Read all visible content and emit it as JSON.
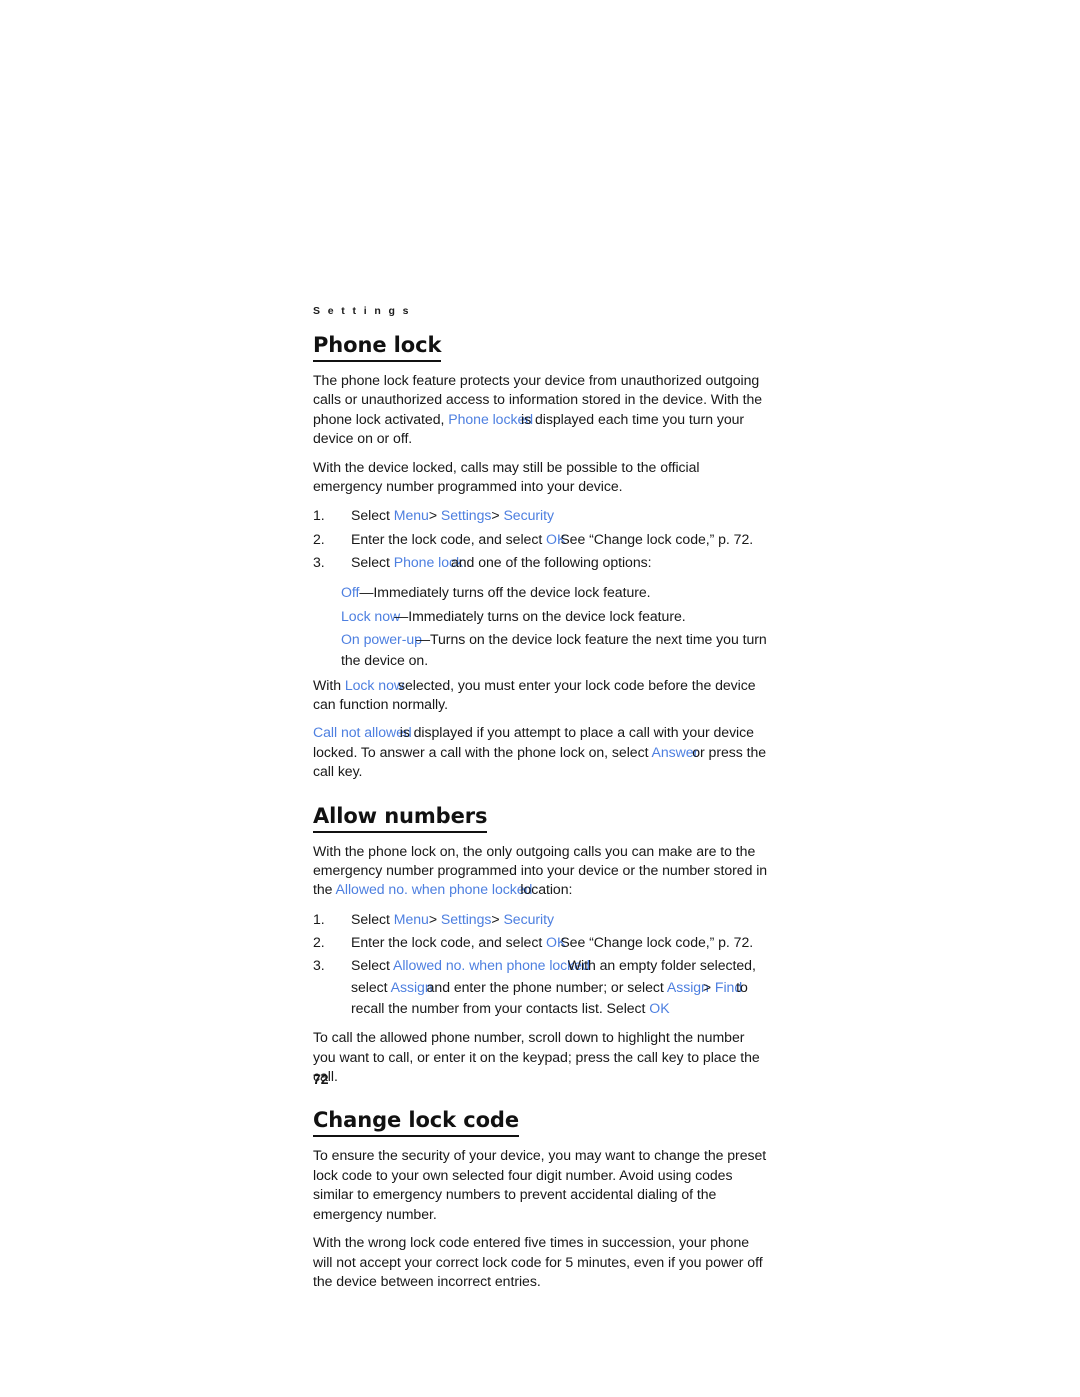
{
  "document": {
    "running_header": "S e t t i n g s",
    "page_number": "72",
    "accent_color": "#4d7fe0",
    "text_color": "#181818"
  },
  "sections": [
    {
      "heading": "Phone lock",
      "intro_paragraphs": [
        {
          "parts": [
            {
              "text": "The phone lock feature protects your device from unauthorized outgoing calls or unauthorized access to information stored in the device. With the phone lock activated, ",
              "style": "normal"
            },
            {
              "text": "Phone locked",
              "style": "ui-overlap"
            },
            {
              "text": "is displayed each time you turn your device on or off.",
              "style": "normal"
            }
          ]
        },
        {
          "parts": [
            {
              "text": "With the device locked, calls may still be possible to the official emergency number programmed into your device.",
              "style": "normal"
            }
          ]
        }
      ],
      "steps": [
        {
          "number": "1.",
          "parts": [
            {
              "text": "Select ",
              "style": "normal"
            },
            {
              "text": "Menu",
              "style": "ui"
            },
            {
              "text": "> ",
              "style": "normal"
            },
            {
              "text": "Settings",
              "style": "ui"
            },
            {
              "text": "> ",
              "style": "normal"
            },
            {
              "text": "Security",
              "style": "ui"
            }
          ]
        },
        {
          "number": "2.",
          "parts": [
            {
              "text": "Enter the lock code, and select ",
              "style": "normal"
            },
            {
              "text": "OK",
              "style": "ui-overlap-sm"
            },
            {
              "text": "See “Change lock code,” p. 72.",
              "style": "normal"
            }
          ]
        },
        {
          "number": "3.",
          "parts": [
            {
              "text": "Select ",
              "style": "normal"
            },
            {
              "text": "Phone lock",
              "style": "ui-overlap"
            },
            {
              "text": "and one of the following options:",
              "style": "normal"
            }
          ]
        }
      ],
      "options": [
        {
          "parts": [
            {
              "text": "Off",
              "style": "ui"
            },
            {
              "text": "—Immediately turns off the device lock feature.",
              "style": "normal"
            }
          ]
        },
        {
          "parts": [
            {
              "text": "Lock now",
              "style": "ui-overlap-sm"
            },
            {
              "text": "—Immediately turns on the device lock feature.",
              "style": "normal"
            }
          ]
        },
        {
          "parts": [
            {
              "text": "On power-up",
              "style": "ui-overlap-sm"
            },
            {
              "text": "—Turns on the device lock feature the next time you turn the device on.",
              "style": "normal"
            }
          ]
        }
      ],
      "outro_paragraphs": [
        {
          "parts": [
            {
              "text": "With ",
              "style": "normal"
            },
            {
              "text": "Lock now",
              "style": "ui-overlap-sm"
            },
            {
              "text": "selected, you must enter your lock code before the device can function normally.",
              "style": "normal"
            }
          ]
        },
        {
          "parts": [
            {
              "text": "Call not allowed",
              "style": "ui-overlap"
            },
            {
              "text": "is displayed if you attempt to place a call with your device locked. To answer a call with the phone lock on, select ",
              "style": "normal"
            },
            {
              "text": "Answer",
              "style": "ui-overlap-sm"
            },
            {
              "text": "or press the call key.",
              "style": "normal"
            }
          ]
        }
      ]
    },
    {
      "heading": "Allow numbers",
      "intro_paragraphs": [
        {
          "parts": [
            {
              "text": "With the phone lock on, the only outgoing calls you can make are to the emergency number programmed into your device or the number stored in the ",
              "style": "normal"
            },
            {
              "text": "Allowed no. when phone locked",
              "style": "ui-overlap"
            },
            {
              "text": "location:",
              "style": "normal"
            }
          ]
        }
      ],
      "steps": [
        {
          "number": "1.",
          "parts": [
            {
              "text": "Select ",
              "style": "normal"
            },
            {
              "text": "Menu",
              "style": "ui"
            },
            {
              "text": "> ",
              "style": "normal"
            },
            {
              "text": "Settings",
              "style": "ui"
            },
            {
              "text": "> ",
              "style": "normal"
            },
            {
              "text": "Security",
              "style": "ui"
            }
          ]
        },
        {
          "number": "2.",
          "parts": [
            {
              "text": "Enter the lock code, and select ",
              "style": "normal"
            },
            {
              "text": "OK",
              "style": "ui-overlap-sm"
            },
            {
              "text": "See “Change lock code,” p. 72.",
              "style": "normal"
            }
          ]
        },
        {
          "number": "3.",
          "parts": [
            {
              "text": "Select ",
              "style": "normal"
            },
            {
              "text": "Allowed no. when phone locked",
              "style": "ui-overlap-lg"
            },
            {
              "text": "With an empty folder selected, select ",
              "style": "normal"
            },
            {
              "text": "Assign",
              "style": "ui-overlap-sm"
            },
            {
              "text": "and enter the phone number; or select ",
              "style": "normal"
            },
            {
              "text": "Assign",
              "style": "ui-overlap-sm"
            },
            {
              "text": "> ",
              "style": "normal"
            },
            {
              "text": "Find",
              "style": "ui-overlap-sm"
            },
            {
              "text": "to recall the number from your contacts list. Select ",
              "style": "normal"
            },
            {
              "text": "OK",
              "style": "ui"
            }
          ]
        }
      ],
      "options": [],
      "outro_paragraphs": [
        {
          "parts": [
            {
              "text": "To call the allowed phone number, scroll down to highlight the number you want to call, or enter it on the keypad; press the call key to place the call.",
              "style": "normal"
            }
          ]
        }
      ]
    },
    {
      "heading": "Change lock code",
      "intro_paragraphs": [
        {
          "parts": [
            {
              "text": "To ensure the security of your device, you may want to change the preset lock code to your own selected four digit number. Avoid using codes similar to emergency numbers to prevent accidental dialing of the emergency number.",
              "style": "normal"
            }
          ]
        },
        {
          "parts": [
            {
              "text": "With the wrong lock code entered five times in succession, your phone will not accept your correct lock code for 5 minutes, even if you power off the device between incorrect entries.",
              "style": "normal"
            }
          ]
        }
      ],
      "steps": [],
      "options": [],
      "outro_paragraphs": []
    }
  ]
}
